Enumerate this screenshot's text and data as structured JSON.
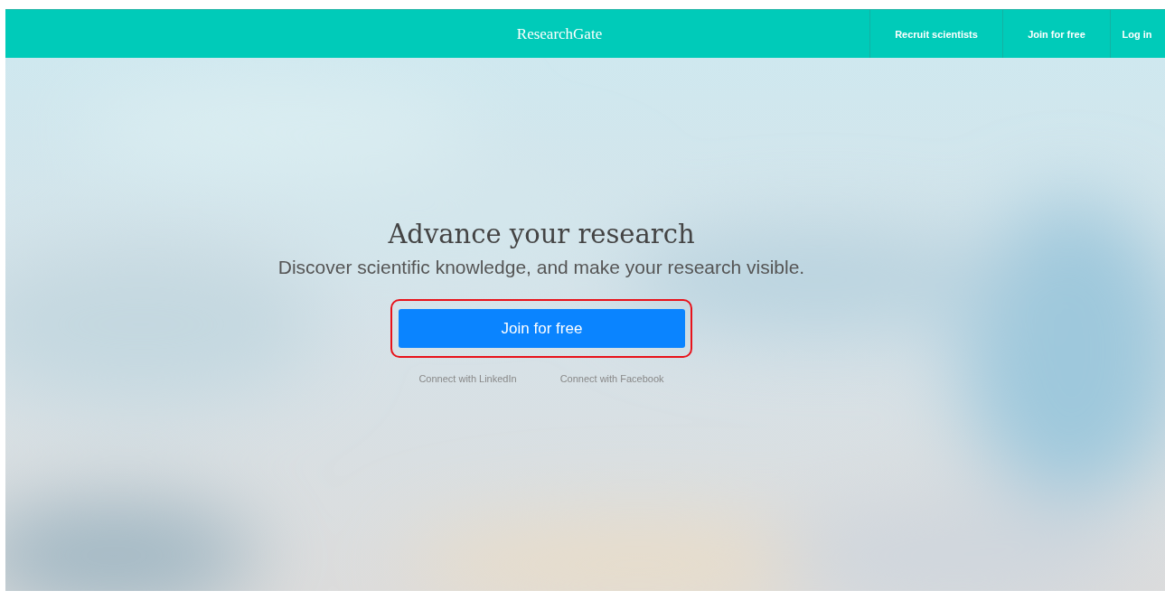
{
  "header": {
    "logo": "ResearchGate",
    "nav": [
      {
        "label": "Recruit scientists"
      },
      {
        "label": "Join for free"
      },
      {
        "label": "Log in"
      }
    ]
  },
  "hero": {
    "title": "Advance your research",
    "subtitle": "Discover scientific knowledge, and make your research visible.",
    "button": "Join for free",
    "links": [
      {
        "label": "Connect with LinkedIn"
      },
      {
        "label": "Connect with Facebook"
      }
    ]
  }
}
